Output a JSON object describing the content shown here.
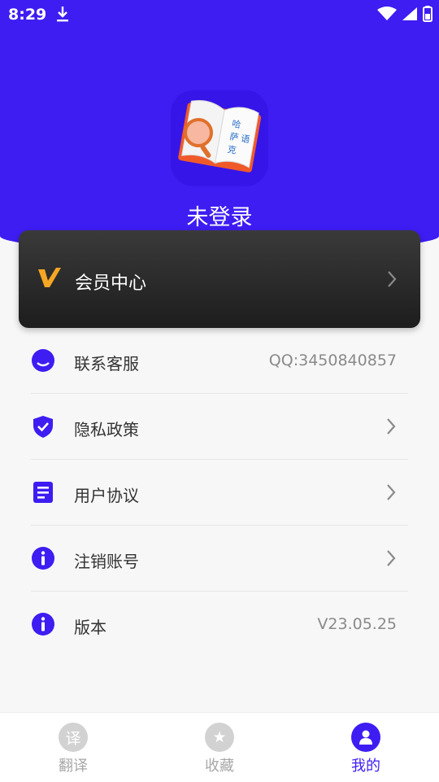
{
  "status_bar": {
    "time": "8:29"
  },
  "profile": {
    "name": "未登录",
    "logo_text": "哈萨克语"
  },
  "vip": {
    "label": "会员中心"
  },
  "menu": [
    {
      "label": "联系客服",
      "value": "QQ:3450840857",
      "icon": "headset-icon"
    },
    {
      "label": "隐私政策",
      "value": "",
      "icon": "shield-check-icon"
    },
    {
      "label": "用户协议",
      "value": "",
      "icon": "document-icon"
    },
    {
      "label": "注销账号",
      "value": "",
      "icon": "info-icon"
    },
    {
      "label": "版本",
      "value": "V23.05.25",
      "icon": "info-icon"
    }
  ],
  "tabs": [
    {
      "label": "翻译",
      "icon_text": "译",
      "active": false
    },
    {
      "label": "收藏",
      "icon_text": "★",
      "active": false
    },
    {
      "label": "我的",
      "icon_text": "",
      "active": true
    }
  ],
  "colors": {
    "primary": "#3d1df2",
    "vip_accent": "#f5a623",
    "card_dark": "#222222"
  }
}
